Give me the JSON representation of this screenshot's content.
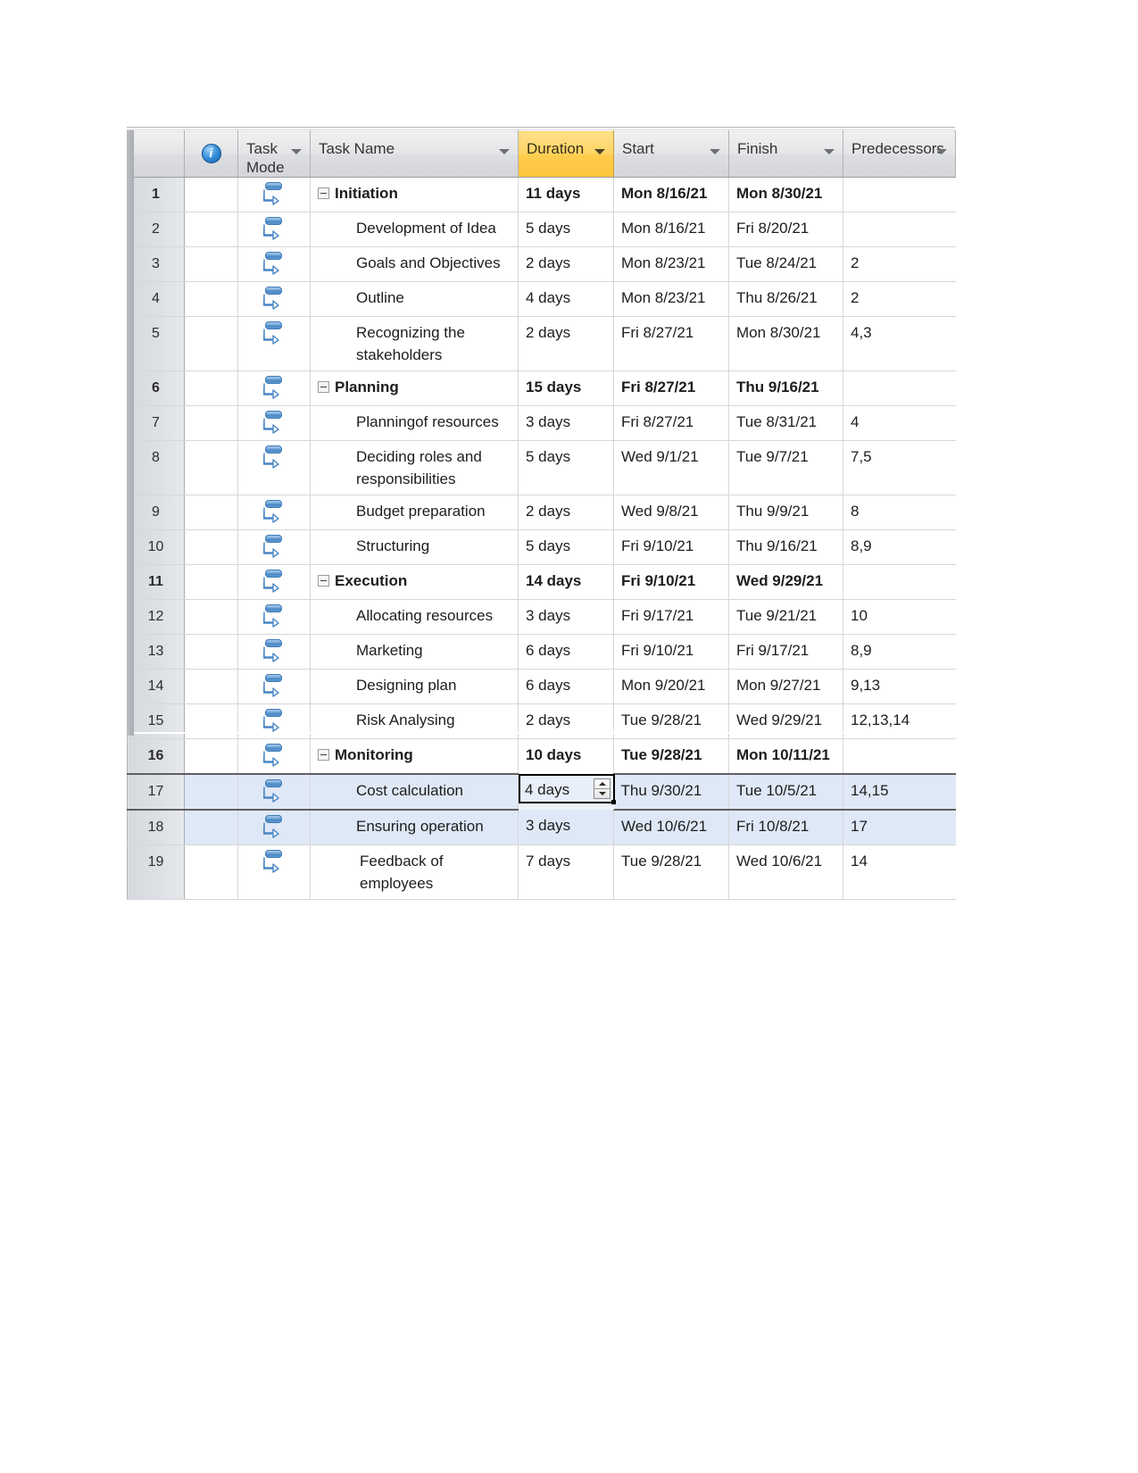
{
  "app": {
    "name": "Microsoft Project",
    "view": "Gantt Chart Entry Table"
  },
  "columns": [
    {
      "id": "id",
      "label": "",
      "sortable": false,
      "highlighted": false
    },
    {
      "id": "indicators",
      "label": "",
      "icon": "info-icon",
      "sortable": false,
      "highlighted": false
    },
    {
      "id": "task_mode",
      "label": "Task Mode",
      "sortable": true,
      "highlighted": false
    },
    {
      "id": "task_name",
      "label": "Task Name",
      "sortable": true,
      "highlighted": false
    },
    {
      "id": "duration",
      "label": "Duration",
      "sortable": true,
      "highlighted": true
    },
    {
      "id": "start",
      "label": "Start",
      "sortable": true,
      "highlighted": false
    },
    {
      "id": "finish",
      "label": "Finish",
      "sortable": true,
      "highlighted": false
    },
    {
      "id": "predecessors",
      "label": "Predecessors",
      "sortable": true,
      "highlighted": false
    }
  ],
  "colors": {
    "header_highlight": "#ffcc4d",
    "row_selected_id": "#f8bf3c",
    "row_highlight": "#dfe8f6",
    "header_bg": "#dcdee1",
    "task_mode_icon": "#4a86c4",
    "info_icon": "#3b93dd",
    "grid_line": "#d6d7d9"
  },
  "selection": {
    "active_cell_row": 17,
    "active_cell_column": "duration",
    "active_cell_value": "4 days",
    "spinner_visible": true,
    "highlighted_rows": [
      17,
      18
    ]
  },
  "rows": [
    {
      "id": "1",
      "mode": "auto-scheduled-icon",
      "name": "Initiation",
      "level": 0,
      "summary": true,
      "expanded": true,
      "duration": "11 days",
      "start": "Mon 8/16/21",
      "finish": "Mon 8/30/21",
      "predecessors": ""
    },
    {
      "id": "2",
      "mode": "auto-scheduled-icon",
      "name": "Development of Idea",
      "level": 1,
      "summary": false,
      "expanded": false,
      "duration": "5 days",
      "start": "Mon 8/16/21",
      "finish": "Fri 8/20/21",
      "predecessors": ""
    },
    {
      "id": "3",
      "mode": "auto-scheduled-icon",
      "name": "Goals and Objectives",
      "level": 1,
      "summary": false,
      "expanded": false,
      "duration": "2 days",
      "start": "Mon 8/23/21",
      "finish": "Tue 8/24/21",
      "predecessors": "2"
    },
    {
      "id": "4",
      "mode": "auto-scheduled-icon",
      "name": "Outline",
      "level": 1,
      "summary": false,
      "expanded": false,
      "duration": "4 days",
      "start": "Mon 8/23/21",
      "finish": "Thu 8/26/21",
      "predecessors": "2"
    },
    {
      "id": "5",
      "mode": "auto-scheduled-icon",
      "name": "Recognizing the stakeholders",
      "level": 1,
      "summary": false,
      "expanded": false,
      "duration": "2 days",
      "start": "Fri 8/27/21",
      "finish": "Mon 8/30/21",
      "predecessors": "4,3"
    },
    {
      "id": "6",
      "mode": "auto-scheduled-icon",
      "name": "Planning",
      "level": 0,
      "summary": true,
      "expanded": true,
      "duration": "15 days",
      "start": "Fri 8/27/21",
      "finish": "Thu 9/16/21",
      "predecessors": ""
    },
    {
      "id": "7",
      "mode": "auto-scheduled-icon",
      "name": "Planningof resources",
      "level": 1,
      "summary": false,
      "expanded": false,
      "duration": "3 days",
      "start": "Fri 8/27/21",
      "finish": "Tue 8/31/21",
      "predecessors": "4"
    },
    {
      "id": "8",
      "mode": "auto-scheduled-icon",
      "name": "Deciding roles and responsibilities",
      "level": 1,
      "summary": false,
      "expanded": false,
      "duration": "5 days",
      "start": "Wed 9/1/21",
      "finish": "Tue 9/7/21",
      "predecessors": "7,5"
    },
    {
      "id": "9",
      "mode": "auto-scheduled-icon",
      "name": "Budget preparation",
      "level": 1,
      "summary": false,
      "expanded": false,
      "duration": "2 days",
      "start": "Wed 9/8/21",
      "finish": "Thu 9/9/21",
      "predecessors": "8"
    },
    {
      "id": "10",
      "mode": "auto-scheduled-icon",
      "name": "Structuring",
      "level": 1,
      "summary": false,
      "expanded": false,
      "duration": "5 days",
      "start": "Fri 9/10/21",
      "finish": "Thu 9/16/21",
      "predecessors": "8,9"
    },
    {
      "id": "11",
      "mode": "auto-scheduled-icon",
      "name": "Execution",
      "level": 0,
      "summary": true,
      "expanded": true,
      "duration": "14 days",
      "start": "Fri 9/10/21",
      "finish": "Wed 9/29/21",
      "predecessors": ""
    },
    {
      "id": "12",
      "mode": "auto-scheduled-icon",
      "name": "Allocating resources",
      "level": 1,
      "summary": false,
      "expanded": false,
      "duration": "3 days",
      "start": "Fri 9/17/21",
      "finish": "Tue 9/21/21",
      "predecessors": "10"
    },
    {
      "id": "13",
      "mode": "auto-scheduled-icon",
      "name": "Marketing",
      "level": 1,
      "summary": false,
      "expanded": false,
      "duration": "6 days",
      "start": "Fri 9/10/21",
      "finish": "Fri 9/17/21",
      "predecessors": "8,9"
    },
    {
      "id": "14",
      "mode": "auto-scheduled-icon",
      "name": "Designing plan",
      "level": 1,
      "summary": false,
      "expanded": false,
      "duration": "6 days",
      "start": "Mon 9/20/21",
      "finish": "Mon 9/27/21",
      "predecessors": "9,13"
    },
    {
      "id": "15",
      "mode": "auto-scheduled-icon",
      "name": "Risk Analysing",
      "level": 1,
      "summary": false,
      "expanded": false,
      "duration": "2 days",
      "start": "Tue 9/28/21",
      "finish": "Wed 9/29/21",
      "predecessors": "12,13,14"
    },
    {
      "id": "16",
      "mode": "auto-scheduled-icon",
      "name": "Monitoring",
      "level": 0,
      "summary": true,
      "expanded": true,
      "duration": "10 days",
      "start": "Tue 9/28/21",
      "finish": "Mon 10/11/21",
      "predecessors": ""
    },
    {
      "id": "17",
      "mode": "auto-scheduled-icon",
      "name": "Cost calculation",
      "level": 1,
      "summary": false,
      "expanded": false,
      "duration": "4 days",
      "start": "Thu 9/30/21",
      "finish": "Tue 10/5/21",
      "predecessors": "14,15"
    },
    {
      "id": "18",
      "mode": "auto-scheduled-icon",
      "name": "Ensuring operation",
      "level": 1,
      "summary": false,
      "expanded": false,
      "duration": "3 days",
      "start": "Wed 10/6/21",
      "finish": "Fri 10/8/21",
      "predecessors": "17"
    },
    {
      "id": "19",
      "mode": "auto-scheduled-icon",
      "name": "Feedback of employees",
      "level": 1,
      "summary": false,
      "expanded": false,
      "duration": "7 days",
      "start": "Tue 9/28/21",
      "finish": "Wed 10/6/21",
      "predecessors": "14"
    }
  ]
}
